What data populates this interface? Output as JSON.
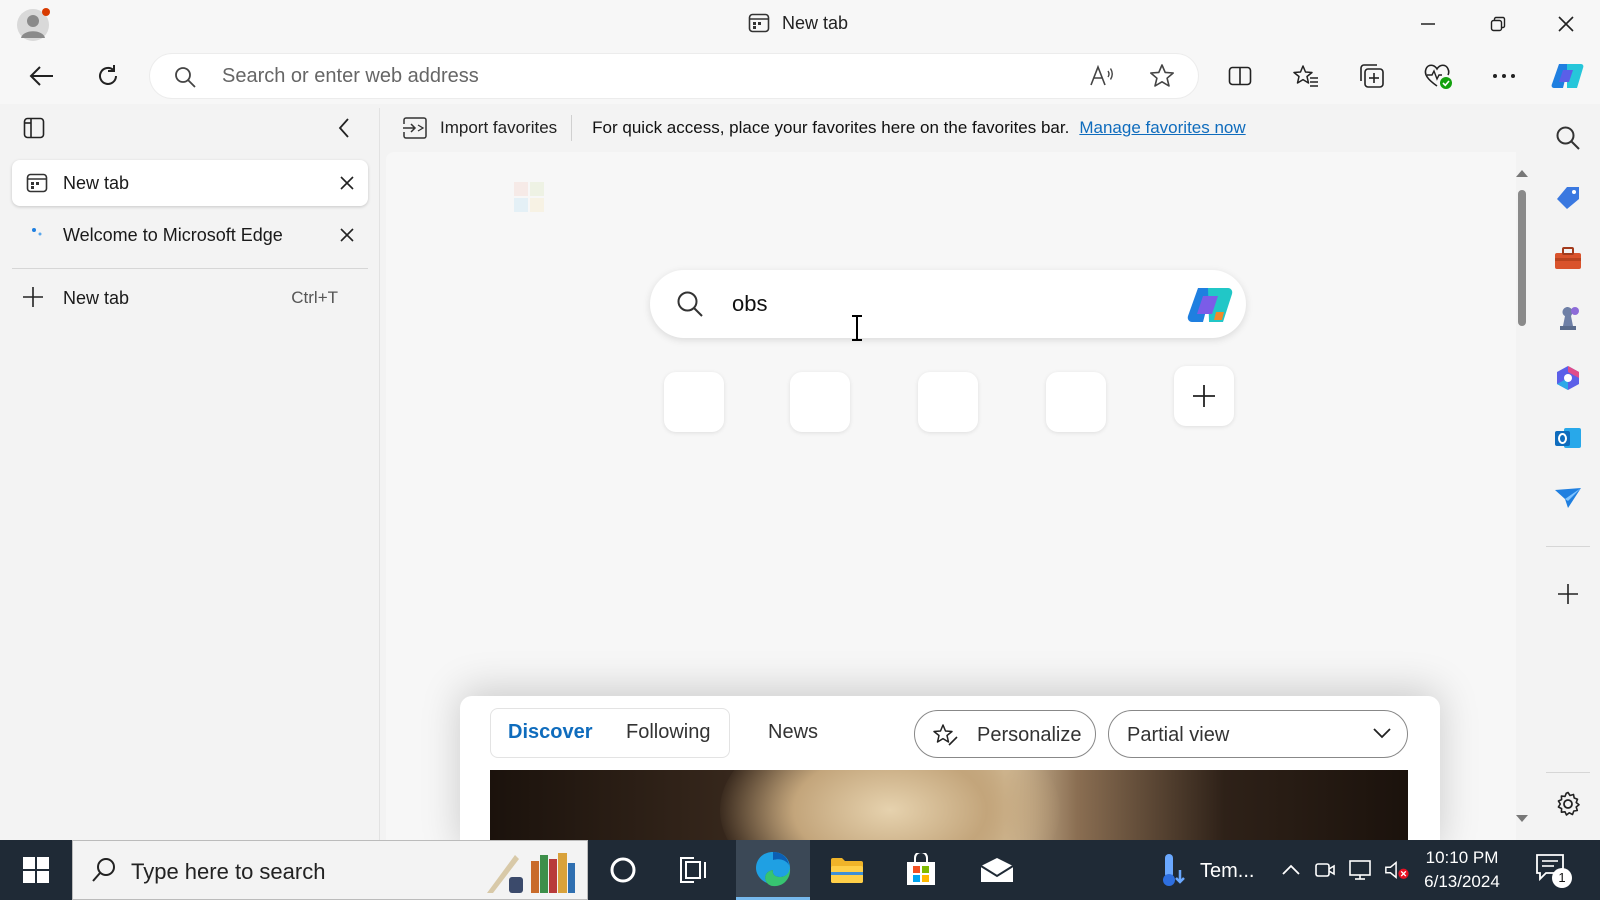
{
  "window": {
    "title": "New tab"
  },
  "toolbar": {
    "address_placeholder": "Search or enter web address"
  },
  "favorites_bar": {
    "import_label": "Import favorites",
    "message": "For quick access, place your favorites here on the favorites bar.",
    "link_label": "Manage favorites now"
  },
  "vertical_tabs": {
    "tabs": [
      {
        "label": "New tab",
        "active": true
      },
      {
        "label": "Welcome to Microsoft Edge",
        "active": false
      }
    ],
    "new_tab": {
      "label": "New tab",
      "shortcut": "Ctrl+T"
    }
  },
  "new_tab_page": {
    "search_value": "obs",
    "feed": {
      "tabs": [
        {
          "label": "Discover",
          "active": true
        },
        {
          "label": "Following",
          "active": false
        }
      ],
      "news_label": "News",
      "personalize_label": "Personalize",
      "view_select": "Partial view"
    }
  },
  "taskbar": {
    "search_placeholder": "Type here to search",
    "weather_label": "Tem...",
    "time": "10:10 PM",
    "date": "6/13/2024",
    "notification_count": "1"
  },
  "colors": {
    "accent": "#0f6cbd",
    "taskbar_bg": "#1f2a36",
    "browser_bg": "#f3f3f3",
    "ms_red": "#f25022",
    "ms_green": "#7fba00",
    "ms_blue": "#00a4ef",
    "ms_yellow": "#ffb900"
  }
}
